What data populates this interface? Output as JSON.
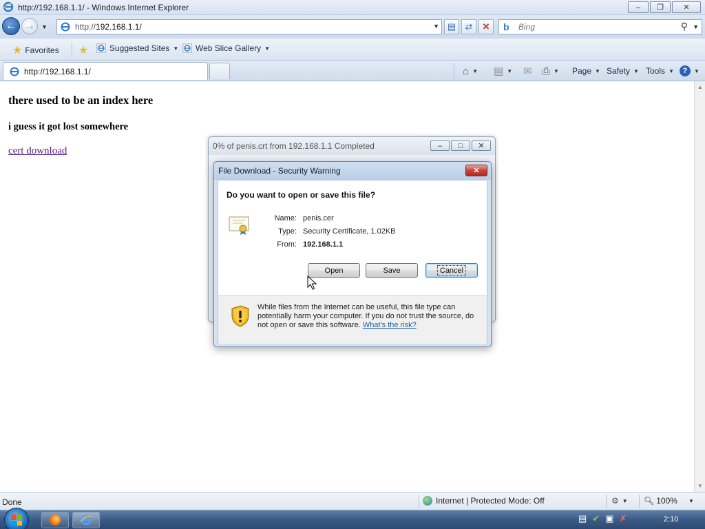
{
  "window": {
    "title": "http://192.168.1.1/ - Windows Internet Explorer",
    "controls": {
      "minimize": "–",
      "maximize": "❐",
      "close": "✕"
    }
  },
  "navigation": {
    "address_url": "http://192.168.1.1/",
    "address_url_prefix": "http://",
    "address_url_host": "192.168.1.1/",
    "search_placeholder": "Bing"
  },
  "favorites_bar": {
    "favorites_label": "Favorites",
    "items": [
      {
        "label": "Suggested Sites"
      },
      {
        "label": "Web Slice Gallery"
      }
    ]
  },
  "tabs": [
    {
      "label": "http://192.168.1.1/",
      "active": true
    }
  ],
  "command_bar": {
    "page_label": "Page",
    "safety_label": "Safety",
    "tools_label": "Tools",
    "help_glyph": "?"
  },
  "page": {
    "heading": "there used to be an index here",
    "subheading": "i guess it got lost somewhere",
    "link_text": "cert download"
  },
  "status_bar": {
    "status_text": "Done",
    "zone_text": "Internet | Protected Mode: Off",
    "zoom_text": "100%"
  },
  "progress_dialog": {
    "title": "0% of penis.crt from 192.168.1.1 Completed"
  },
  "security_dialog": {
    "title": "File Download - Security Warning",
    "question": "Do you want to open or save this file?",
    "name_label": "Name:",
    "name_value": "penis.cer",
    "type_label": "Type:",
    "type_value": "Security Certificate, 1.02KB",
    "from_label": "From:",
    "from_value": "192.168.1.1",
    "open_button": "Open",
    "save_button": "Save",
    "cancel_button": "Cancel",
    "warning_text": "While files from the Internet can be useful, this file type can potentially harm your computer. If you do not trust the source, do not open or save this software.",
    "warning_link": "What's the risk?"
  },
  "taskbar": {
    "clock": "2:10"
  },
  "colors": {
    "link_visited": "#551a8b",
    "dialog_close_red": "#c7463a",
    "ie_blue": "#1e4f9a",
    "taskbar": "#3b5b86"
  }
}
